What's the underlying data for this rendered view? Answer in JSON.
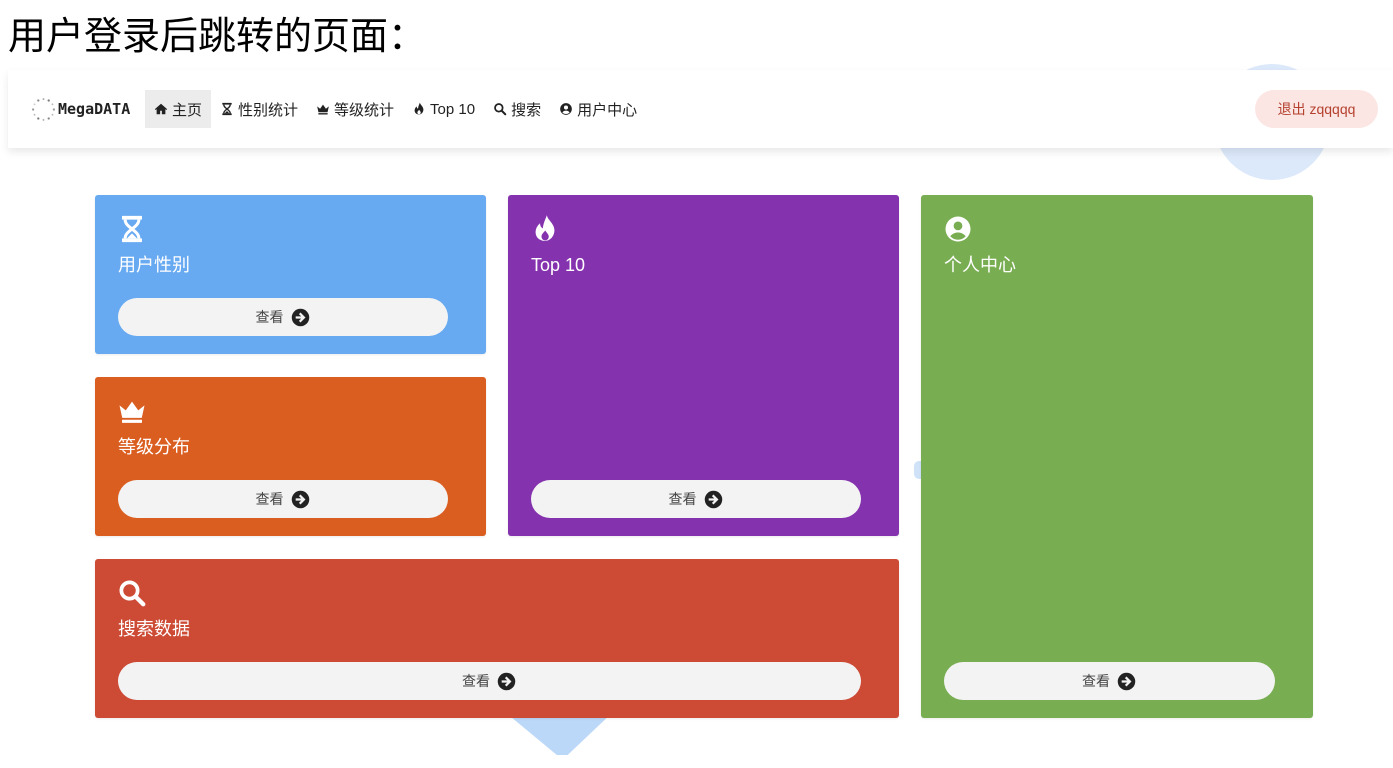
{
  "caption": "用户登录后跳转的页面：",
  "navbar": {
    "brand": "MegaDATA",
    "brand_icon": "dotted-circle-logo-icon",
    "items": [
      {
        "icon": "home-icon",
        "label": "主页",
        "active": true
      },
      {
        "icon": "hourglass-icon",
        "label": "性别统计",
        "active": false
      },
      {
        "icon": "crown-icon",
        "label": "等级统计",
        "active": false
      },
      {
        "icon": "fire-icon",
        "label": "Top 10",
        "active": false
      },
      {
        "icon": "search-icon",
        "label": "搜索",
        "active": false
      },
      {
        "icon": "user-circle-icon",
        "label": "用户中心",
        "active": false
      }
    ],
    "logout": {
      "label": "退出 zqqqqq",
      "background": "#fbe6e3",
      "color": "#b5402f"
    }
  },
  "cards": [
    {
      "icon": "hourglass-icon",
      "title": "用户性别",
      "button_label": "查看",
      "button_icon": "arrow-circle-right-icon",
      "color": "#67aaf1"
    },
    {
      "icon": "fire-icon",
      "title": "Top 10",
      "button_label": "查看",
      "button_icon": "arrow-circle-right-icon",
      "color": "#8532ae"
    },
    {
      "icon": "user-circle-icon",
      "title": "个人中心",
      "button_label": "查看",
      "button_icon": "arrow-circle-right-icon",
      "color": "#79ad52"
    },
    {
      "icon": "crown-icon",
      "title": "等级分布",
      "button_label": "查看",
      "button_icon": "arrow-circle-right-icon",
      "color": "#db5e21"
    },
    {
      "icon": "search-icon",
      "title": "搜索数据",
      "button_label": "查看",
      "button_icon": "arrow-circle-right-icon",
      "color": "#cd4a35"
    }
  ]
}
